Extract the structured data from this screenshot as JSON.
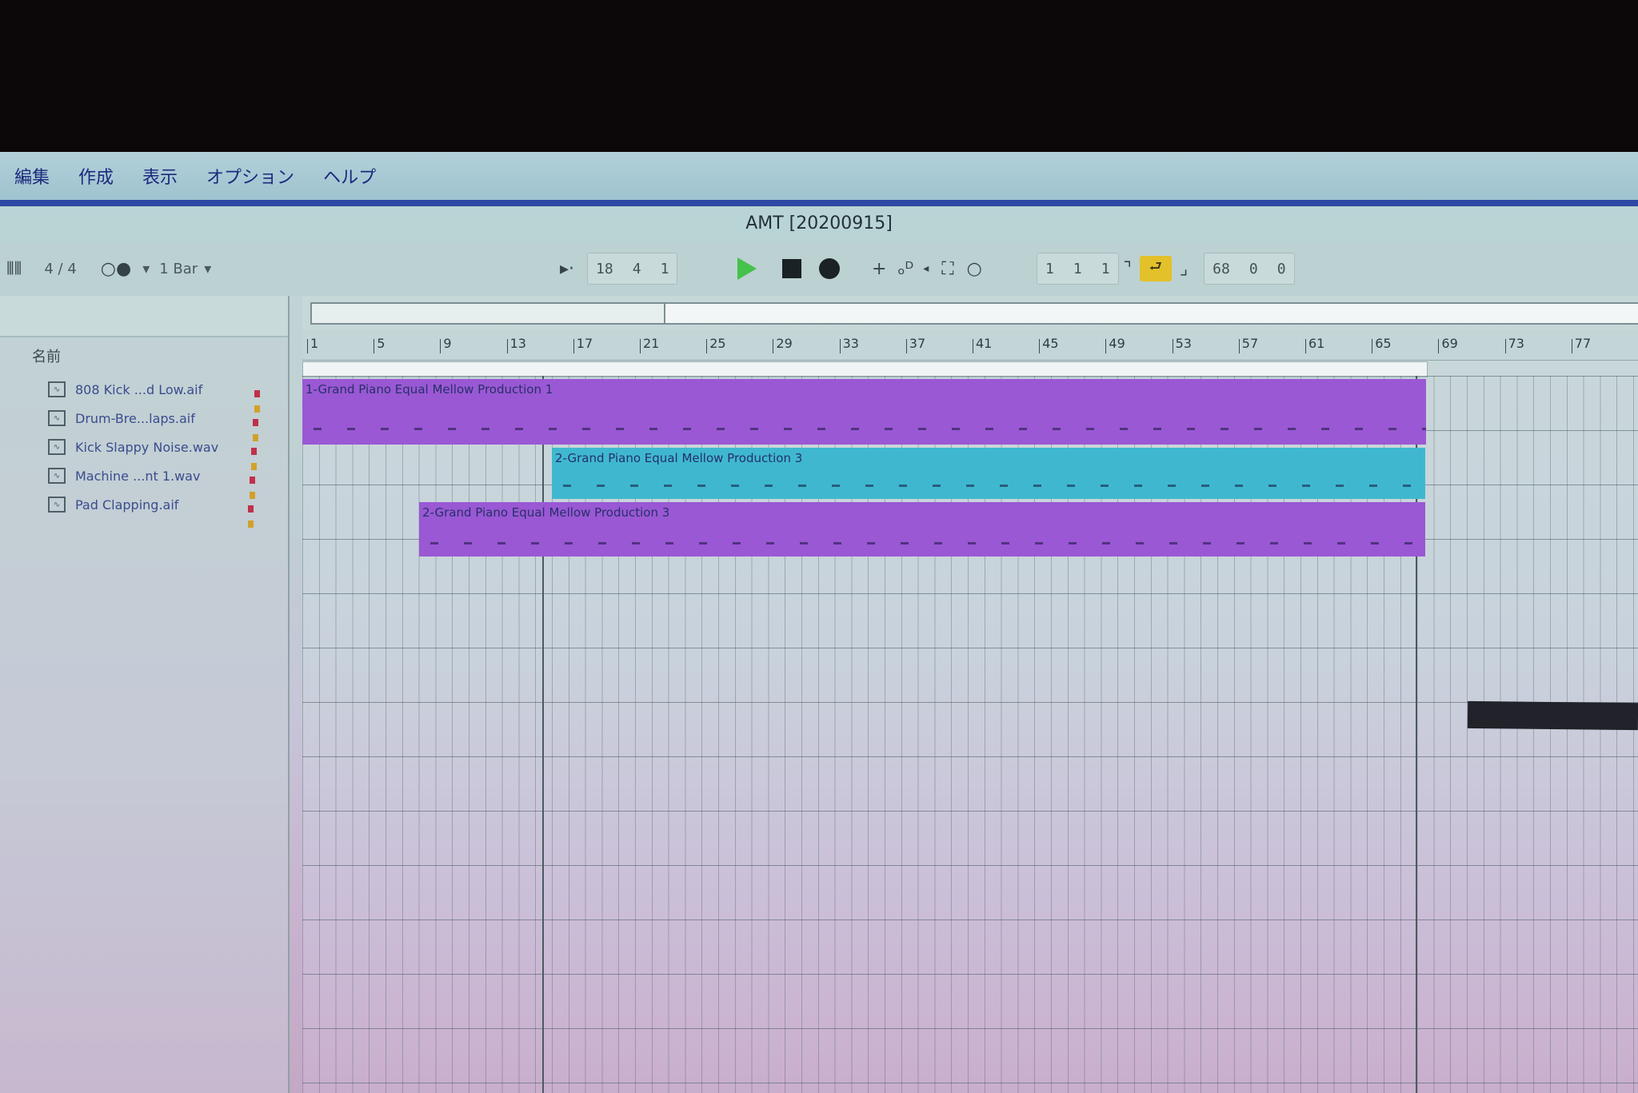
{
  "menubar": {
    "items": [
      "編集",
      "作成",
      "表示",
      "オプション",
      "ヘルプ"
    ]
  },
  "window": {
    "title": "AMT  [20200915]"
  },
  "toolbar": {
    "time_signature": "4 / 4",
    "quantize": "1 Bar",
    "position": [
      "18",
      "4",
      "1"
    ],
    "loop_start": [
      "1",
      "1",
      "1"
    ],
    "loop_length": [
      "68",
      "0",
      "0"
    ]
  },
  "browser": {
    "header": "名前",
    "files": [
      {
        "name": "808 Kick ...d Low.aif"
      },
      {
        "name": "Drum-Bre...laps.aif"
      },
      {
        "name": "Kick Slappy Noise.wav"
      },
      {
        "name": "Machine ...nt 1.wav"
      },
      {
        "name": "Pad Clapping.aif"
      }
    ]
  },
  "ruler": {
    "bars": [
      "1",
      "5",
      "9",
      "13",
      "17",
      "21",
      "25",
      "29",
      "33",
      "37",
      "41",
      "45",
      "49",
      "53",
      "57",
      "61",
      "65",
      "69",
      "73",
      "77"
    ]
  },
  "clips": [
    {
      "name": "1-Grand Piano Equal Mellow Production 1",
      "color": "#9a58d4"
    },
    {
      "name": "2-Grand Piano Equal Mellow Production 3",
      "color": "#3fb8cf"
    },
    {
      "name": "2-Grand Piano Equal Mellow Production 3",
      "color": "#9a58d4"
    }
  ],
  "colors": {
    "accent_loop": "#e3c12a",
    "play": "#44c24a",
    "menu_text": "#1c2a7e"
  }
}
